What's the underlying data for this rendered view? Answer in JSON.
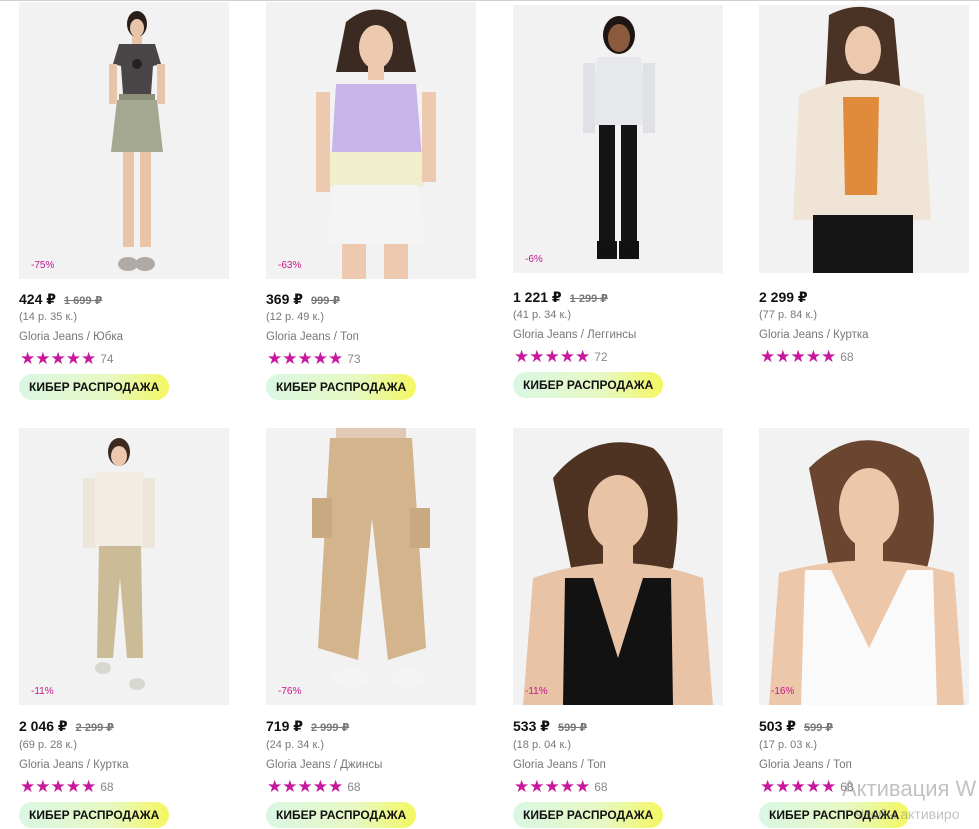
{
  "products": [
    {
      "discount": "-75%",
      "price": "424 ₽",
      "old_price": "1 699 ₽",
      "installment": "(14 р. 35 к.)",
      "brand_category": "Gloria Jeans / Юбка",
      "stars": "★★★★★",
      "rating_count": "74",
      "badge": "КИБЕР РАСПРОДАЖА"
    },
    {
      "discount": "-63%",
      "price": "369 ₽",
      "old_price": "999 ₽",
      "installment": "(12 р. 49 к.)",
      "brand_category": "Gloria Jeans / Топ",
      "stars": "★★★★★",
      "rating_count": "73",
      "badge": "КИБЕР РАСПРОДАЖА"
    },
    {
      "discount": "-6%",
      "price": "1 221 ₽",
      "old_price": "1 299 ₽",
      "installment": "(41 р. 34 к.)",
      "brand_category": "Gloria Jeans / Леггинсы",
      "stars": "★★★★★",
      "rating_count": "72",
      "badge": "КИБЕР РАСПРОДАЖА"
    },
    {
      "discount": "",
      "price": "2 299 ₽",
      "old_price": "",
      "installment": "(77 р. 84 к.)",
      "brand_category": "Gloria Jeans / Куртка",
      "stars": "★★★★★",
      "rating_count": "68",
      "badge": ""
    },
    {
      "discount": "-11%",
      "price": "2 046 ₽",
      "old_price": "2 299 ₽",
      "installment": "(69 р. 28 к.)",
      "brand_category": "Gloria Jeans / Куртка",
      "stars": "★★★★★",
      "rating_count": "68",
      "badge": "КИБЕР РАСПРОДАЖА"
    },
    {
      "discount": "-76%",
      "price": "719 ₽",
      "old_price": "2 999 ₽",
      "installment": "(24 р. 34 к.)",
      "brand_category": "Gloria Jeans / Джинсы",
      "stars": "★★★★★",
      "rating_count": "68",
      "badge": "КИБЕР РАСПРОДАЖА"
    },
    {
      "discount": "-11%",
      "price": "533 ₽",
      "old_price": "599 ₽",
      "installment": "(18 р. 04 к.)",
      "brand_category": "Gloria Jeans / Топ",
      "stars": "★★★★★",
      "rating_count": "68",
      "badge": "КИБЕР РАСПРОДАЖА"
    },
    {
      "discount": "-16%",
      "price": "503 ₽",
      "old_price": "599 ₽",
      "installment": "(17 р. 03 к.)",
      "brand_category": "Gloria Jeans / Топ",
      "stars": "★★★★★",
      "rating_count": "68",
      "badge": "КИБЕР РАСПРОДАЖА"
    }
  ],
  "watermark": {
    "line1": "Активация W",
    "line2": "Чтобы активиро"
  },
  "colors": {
    "accent": "#c8189e",
    "discount_text": "#c2188a",
    "badge_start": "#d9f7e4",
    "badge_end": "#f4f760"
  }
}
